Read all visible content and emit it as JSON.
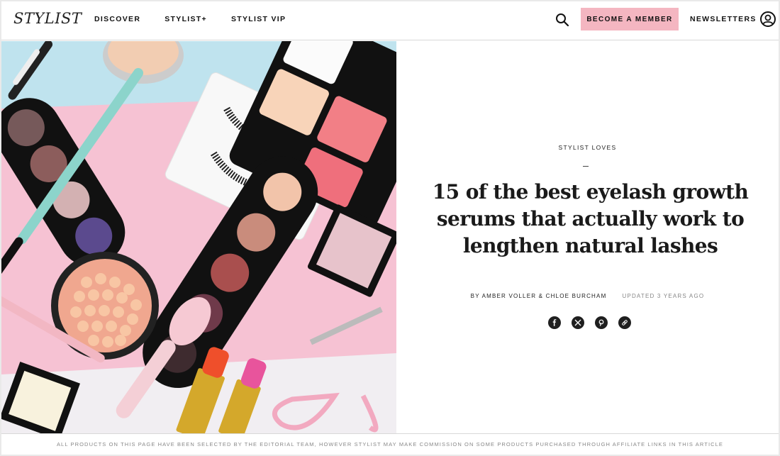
{
  "header": {
    "logo": "STYLIST",
    "nav": [
      "DISCOVER",
      "STYLIST+",
      "STYLIST VIP"
    ],
    "search_icon": "search-icon",
    "member_button": "BECOME A MEMBER",
    "newsletters": "NEWSLETTERS",
    "account_icon": "account-icon",
    "colors": {
      "member_bg": "#f4b6c1"
    }
  },
  "hero": {
    "icon": "makeup-flatlay-image"
  },
  "article": {
    "category": "STYLIST LOVES",
    "dash": "–",
    "title": "15 of the best eyelash growth serums that actually work to lengthen natural lashes",
    "author": "BY AMBER VOLLER & CHLOE BURCHAM",
    "updated": "UPDATED 3 YEARS AGO",
    "share": [
      "facebook-icon",
      "x-icon",
      "pinterest-icon",
      "link-icon"
    ]
  },
  "footer": {
    "disclaimer": "ALL PRODUCTS ON THIS PAGE HAVE BEEN SELECTED BY THE EDITORIAL TEAM, HOWEVER STYLIST MAY MAKE COMMISSION ON SOME PRODUCTS PURCHASED THROUGH AFFILIATE LINKS IN THIS ARTICLE"
  }
}
